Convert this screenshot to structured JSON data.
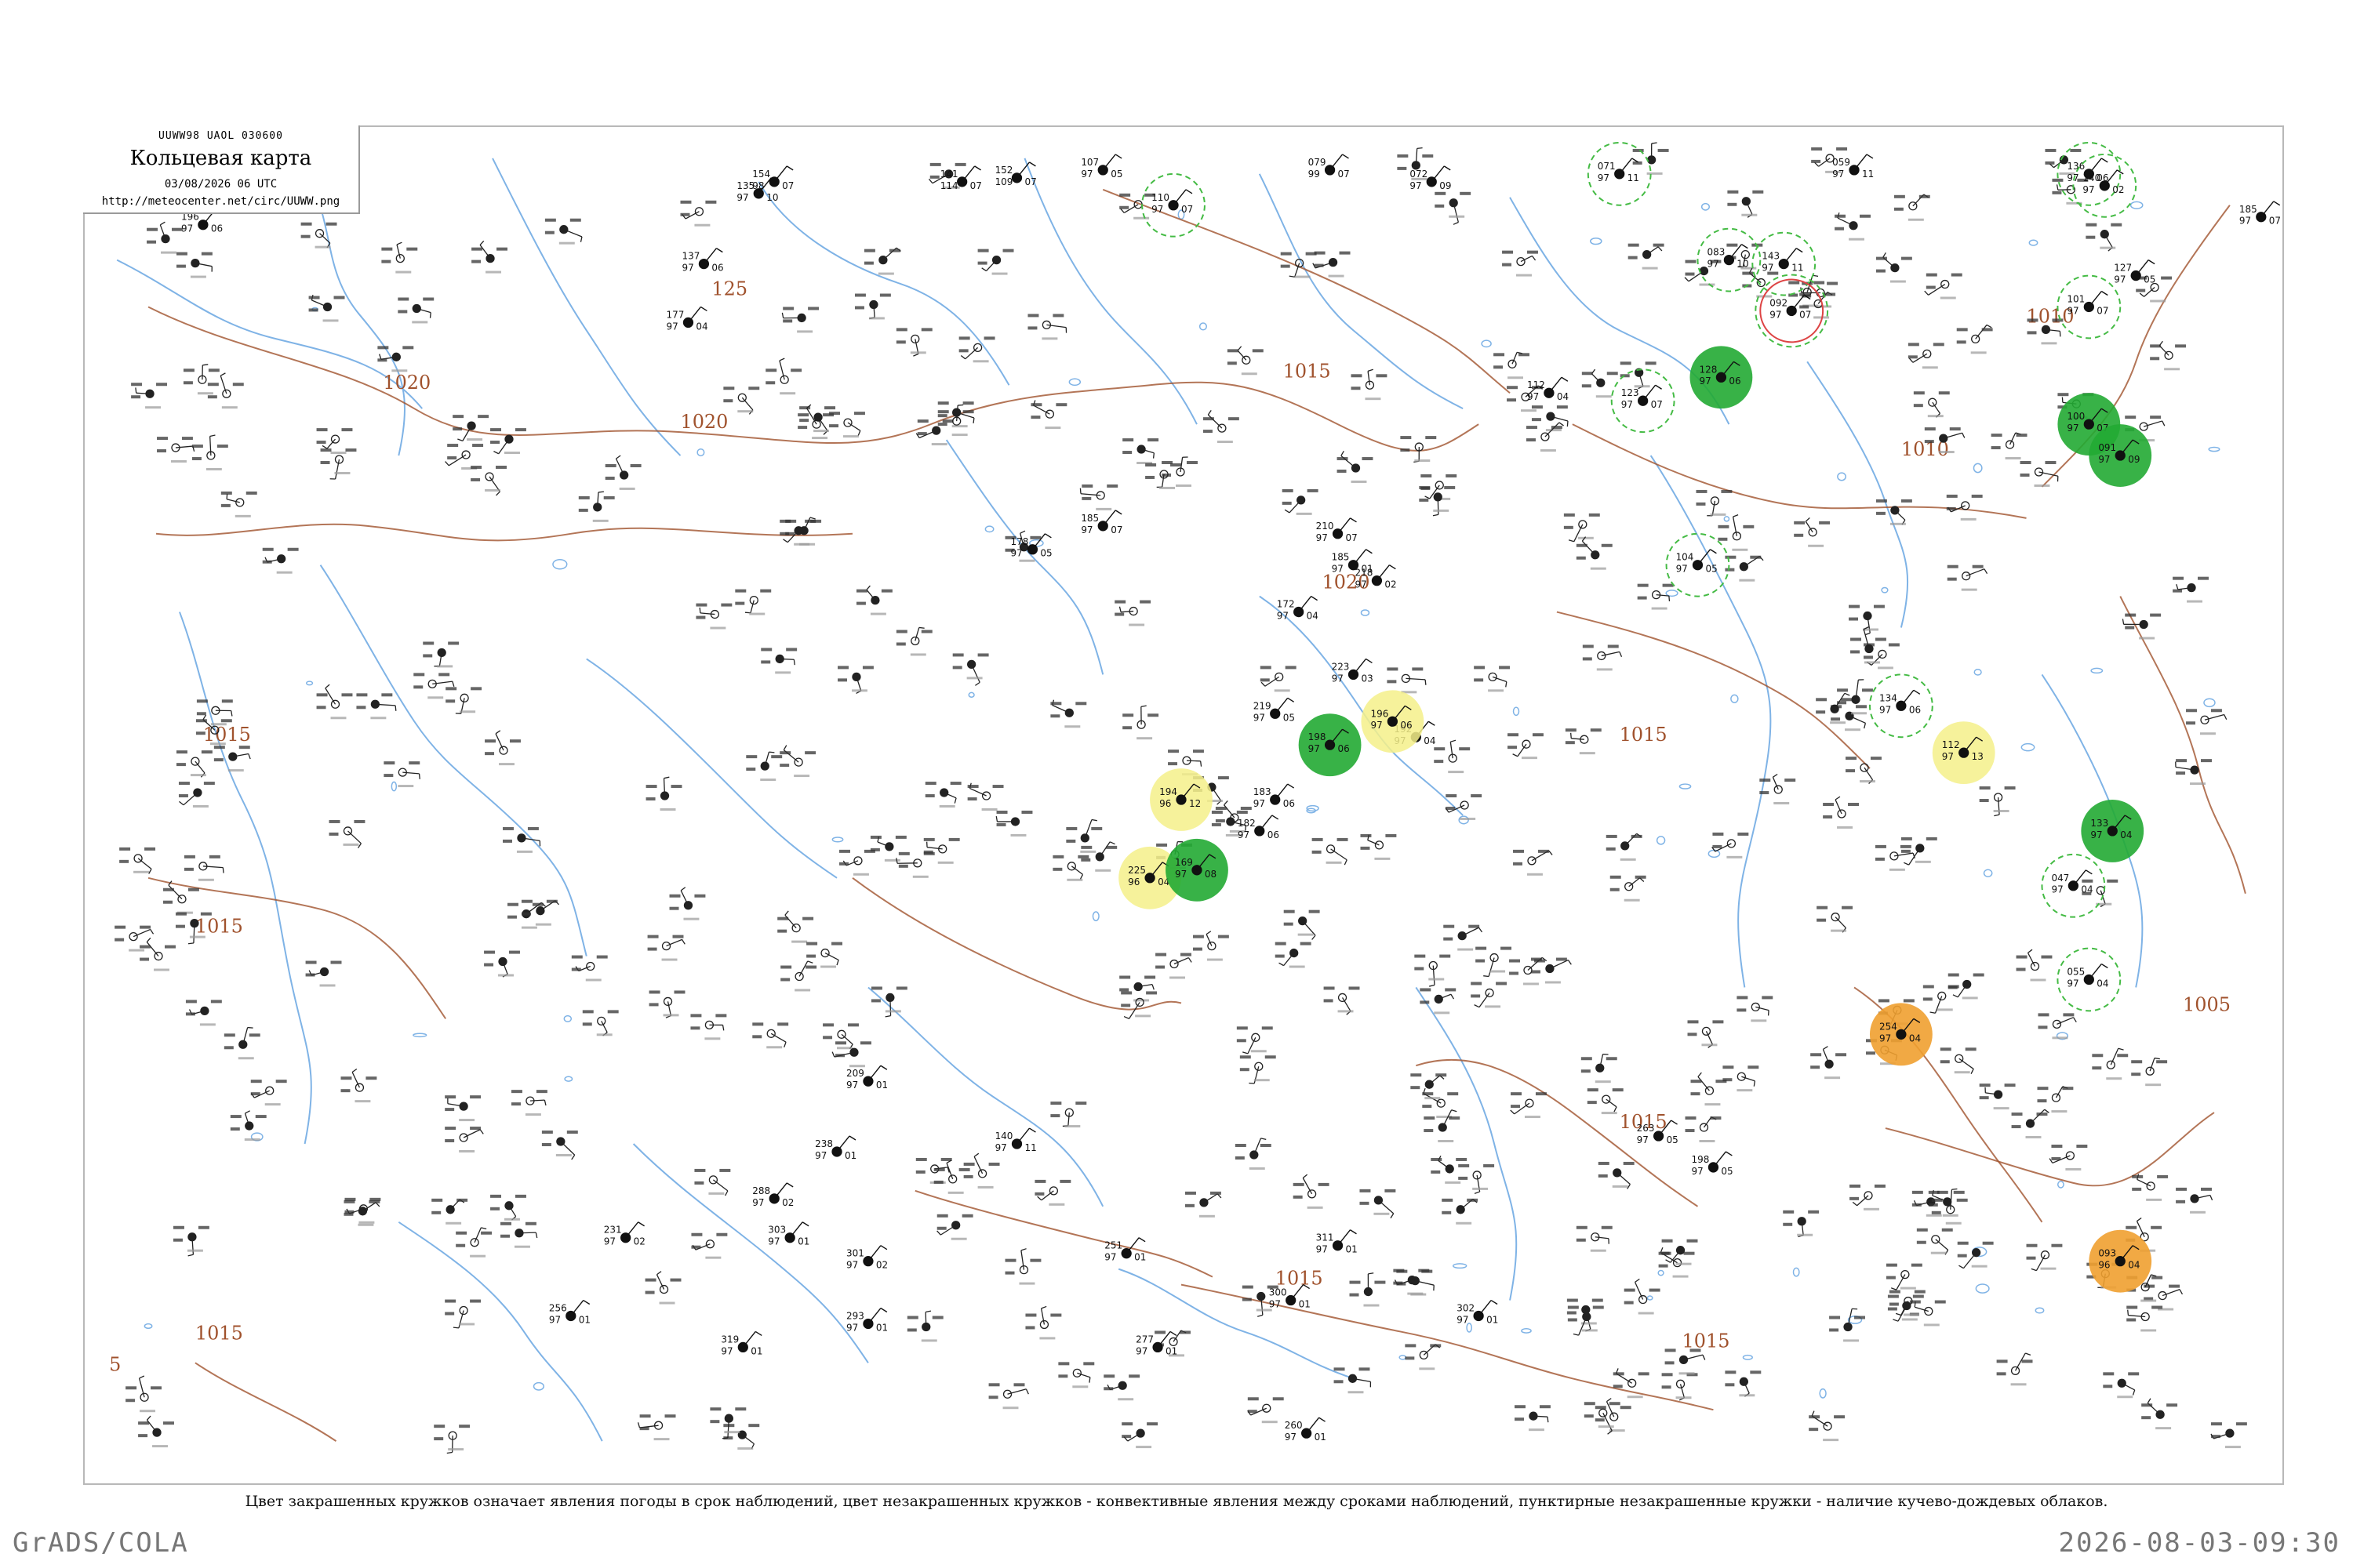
{
  "map": {
    "code": "UUWW98  UAOL  030600",
    "title": "Кольцевая карта",
    "date": "03/08/2026 06 UTC",
    "url": "http://meteocenter.net/circ/UUWW.png",
    "caption": "Цвет закрашенных кружков означает явления погоды в срок наблюдений, цвет незакрашенных кружков - конвективные явления между сроками наблюдений, пунктирные незакрашенные кружки - наличие кучево-дождевых облаков.",
    "footer_left": "GrADS/COLA",
    "footer_right": "2026-08-03-09:30",
    "colors": {
      "isobar": "#a0522d",
      "river": "#7fb3e6",
      "cb_circle": "#44bb44",
      "rain_fill": "#22aa33",
      "light_rain_fill": "#f5f08a",
      "haze_fill": "#f0a030",
      "thunder_circle": "#dd4444"
    },
    "isobar_labels": [
      {
        "text": "1020"
      },
      {
        "text": "1020"
      },
      {
        "text": "1015"
      },
      {
        "text": "1015"
      },
      {
        "text": "1015"
      },
      {
        "text": "1020"
      },
      {
        "text": "1015"
      },
      {
        "text": "1015"
      },
      {
        "text": "1015"
      },
      {
        "text": "1010"
      },
      {
        "text": "1010"
      },
      {
        "text": "1005"
      },
      {
        "text": "1015"
      },
      {
        "text": "5"
      },
      {
        "text": "1015"
      },
      {
        "text": "125"
      }
    ],
    "stations": [
      {
        "temp": "135",
        "pres": "97",
        "dew": "10",
        "kind": "plain"
      },
      {
        "temp": "154",
        "pres": "98",
        "dew": "07",
        "kind": "plain"
      },
      {
        "temp": "141",
        "pres": "114",
        "dew": "07",
        "kind": "plain"
      },
      {
        "temp": "152",
        "pres": "109",
        "dew": "07",
        "kind": "plain"
      },
      {
        "temp": "107",
        "pres": "97",
        "dew": "05",
        "kind": "plain"
      },
      {
        "temp": "110",
        "pres": "97",
        "dew": "07",
        "kind": "cb"
      },
      {
        "temp": "079",
        "pres": "99",
        "dew": "07",
        "kind": "plain"
      },
      {
        "temp": "072",
        "pres": "97",
        "dew": "09",
        "kind": "plain"
      },
      {
        "temp": "071",
        "pres": "97",
        "dew": "11",
        "kind": "cb"
      },
      {
        "temp": "059",
        "pres": "97",
        "dew": "11",
        "kind": "plain"
      },
      {
        "temp": "136",
        "pres": "97",
        "dew": "06",
        "kind": "cb"
      },
      {
        "temp": "196",
        "pres": "97",
        "dew": "06",
        "kind": "plain"
      },
      {
        "temp": "137",
        "pres": "97",
        "dew": "06",
        "kind": "plain"
      },
      {
        "temp": "177",
        "pres": "97",
        "dew": "04",
        "kind": "plain"
      },
      {
        "temp": "185",
        "pres": "97",
        "dew": "07",
        "kind": "plain"
      },
      {
        "temp": "140",
        "pres": "97",
        "dew": "02",
        "kind": "cb"
      },
      {
        "temp": "143",
        "pres": "97",
        "dew": "11",
        "kind": "cb"
      },
      {
        "temp": "083",
        "pres": "97",
        "dew": "10",
        "kind": "cb"
      },
      {
        "temp": "092",
        "pres": "97",
        "dew": "07",
        "kind": "thunder"
      },
      {
        "temp": "127",
        "pres": "97",
        "dew": "05",
        "kind": "plain"
      },
      {
        "temp": "101",
        "pres": "97",
        "dew": "07",
        "kind": "cb"
      },
      {
        "temp": "178",
        "pres": "97",
        "dew": "05",
        "kind": "plain"
      },
      {
        "temp": "185",
        "pres": "97",
        "dew": "07",
        "kind": "plain"
      },
      {
        "temp": "210",
        "pres": "97",
        "dew": "07",
        "kind": "plain"
      },
      {
        "temp": "185",
        "pres": "97",
        "dew": "01",
        "kind": "plain"
      },
      {
        "temp": "218",
        "pres": "97",
        "dew": "02",
        "kind": "plain"
      },
      {
        "temp": "172",
        "pres": "97",
        "dew": "04",
        "kind": "plain"
      },
      {
        "temp": "192",
        "pres": "97",
        "dew": "04",
        "kind": "plain"
      },
      {
        "temp": "183",
        "pres": "97",
        "dew": "06",
        "kind": "plain"
      },
      {
        "temp": "182",
        "pres": "97",
        "dew": "06",
        "kind": "plain"
      },
      {
        "temp": "123",
        "pres": "97",
        "dew": "07",
        "kind": "cb"
      },
      {
        "temp": "128",
        "pres": "97",
        "dew": "06",
        "kind": "rain"
      },
      {
        "temp": "112",
        "pres": "97",
        "dew": "04",
        "kind": "plain"
      },
      {
        "temp": "100",
        "pres": "97",
        "dew": "07",
        "kind": "rain"
      },
      {
        "temp": "091",
        "pres": "97",
        "dew": "09",
        "kind": "rain"
      },
      {
        "temp": "223",
        "pres": "97",
        "dew": "03",
        "kind": "plain"
      },
      {
        "temp": "219",
        "pres": "97",
        "dew": "05",
        "kind": "plain"
      },
      {
        "temp": "196",
        "pres": "97",
        "dew": "06",
        "kind": "lightrain"
      },
      {
        "temp": "198",
        "pres": "97",
        "dew": "06",
        "kind": "rain"
      },
      {
        "temp": "194",
        "pres": "96",
        "dew": "12",
        "kind": "lightrain"
      },
      {
        "temp": "225",
        "pres": "96",
        "dew": "04",
        "kind": "lightrain"
      },
      {
        "temp": "169",
        "pres": "97",
        "dew": "08",
        "kind": "rain"
      },
      {
        "temp": "134",
        "pres": "97",
        "dew": "06",
        "kind": "cb"
      },
      {
        "temp": "112",
        "pres": "97",
        "dew": "13",
        "kind": "lightrain"
      },
      {
        "temp": "104",
        "pres": "97",
        "dew": "05",
        "kind": "cb"
      },
      {
        "temp": "133",
        "pres": "97",
        "dew": "04",
        "kind": "rain"
      },
      {
        "temp": "047",
        "pres": "97",
        "dew": "04",
        "kind": "cb"
      },
      {
        "temp": "254",
        "pres": "97",
        "dew": "04",
        "kind": "haze"
      },
      {
        "temp": "055",
        "pres": "97",
        "dew": "04",
        "kind": "cb"
      },
      {
        "temp": "093",
        "pres": "96",
        "dew": "04",
        "kind": "haze"
      },
      {
        "temp": "263",
        "pres": "97",
        "dew": "05",
        "kind": "plain"
      },
      {
        "temp": "198",
        "pres": "97",
        "dew": "05",
        "kind": "plain"
      },
      {
        "temp": "140",
        "pres": "97",
        "dew": "11",
        "kind": "plain"
      },
      {
        "temp": "209",
        "pres": "97",
        "dew": "01",
        "kind": "plain"
      },
      {
        "temp": "238",
        "pres": "97",
        "dew": "01",
        "kind": "plain"
      },
      {
        "temp": "288",
        "pres": "97",
        "dew": "02",
        "kind": "plain"
      },
      {
        "temp": "303",
        "pres": "97",
        "dew": "01",
        "kind": "plain"
      },
      {
        "temp": "301",
        "pres": "97",
        "dew": "02",
        "kind": "plain"
      },
      {
        "temp": "293",
        "pres": "97",
        "dew": "01",
        "kind": "plain"
      },
      {
        "temp": "256",
        "pres": "97",
        "dew": "01",
        "kind": "plain"
      },
      {
        "temp": "231",
        "pres": "97",
        "dew": "02",
        "kind": "plain"
      },
      {
        "temp": "251",
        "pres": "97",
        "dew": "01",
        "kind": "plain"
      },
      {
        "temp": "277",
        "pres": "97",
        "dew": "01",
        "kind": "plain"
      },
      {
        "temp": "300",
        "pres": "97",
        "dew": "01",
        "kind": "plain"
      },
      {
        "temp": "311",
        "pres": "97",
        "dew": "01",
        "kind": "plain"
      },
      {
        "temp": "302",
        "pres": "97",
        "dew": "01",
        "kind": "plain"
      },
      {
        "temp": "260",
        "pres": "97",
        "dew": "01",
        "kind": "plain"
      },
      {
        "temp": "319",
        "pres": "97",
        "dew": "01",
        "kind": "plain"
      }
    ]
  }
}
